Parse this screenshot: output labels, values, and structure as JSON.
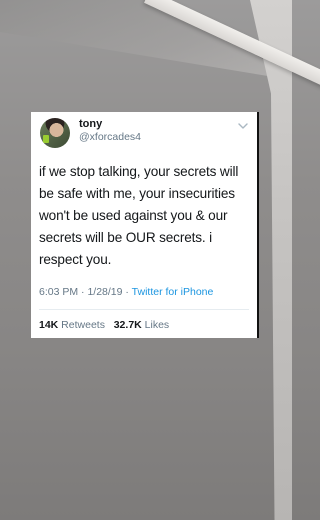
{
  "tweet": {
    "name": "tony",
    "handle": "@xforcades4",
    "text": "if we stop talking, your secrets will be safe with me, your insecurities won't be used against you & our secrets will be OUR secrets. i respect you.",
    "time": "6:03 PM",
    "sep1": " · ",
    "date": "1/28/19",
    "sep2": " · ",
    "source": "Twitter for iPhone",
    "retweets_count": "14K",
    "retweets_label": " Retweets",
    "likes_count": "32.7K",
    "likes_label": " Likes",
    "icons": {
      "avatar": "profile-avatar",
      "menu": "chevron-down-icon"
    }
  }
}
